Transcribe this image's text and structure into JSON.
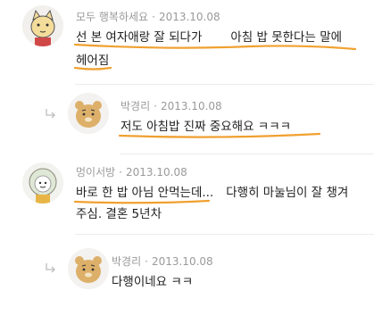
{
  "comments": [
    {
      "author": "모두 행복하세요",
      "date": "2013.10.08",
      "text_line1_a": "선 본 여자애랑 잘 되다가",
      "text_line1_b": "아침 밥 못한다는 말에",
      "text_line2": "헤어짐"
    },
    {
      "author": "박경리",
      "date": "2013.10.08",
      "text_line1": "저도 아침밥 진짜 중요해요 ㅋㅋㅋ"
    },
    {
      "author": "멍이서방",
      "date": "2013.10.08",
      "text_line1_a": "바로 한 밥 아님 안먹는데...",
      "text_line1_b": "다행히 마눌님이 잘 챙겨",
      "text_line2": "주심. 결혼 5년차"
    },
    {
      "author": "박경리",
      "date": "2013.10.08",
      "text_line1": "다행이네요 ㅋㅋ"
    }
  ],
  "separator": "·",
  "colors": {
    "highlight": "#f0a030",
    "meta": "#9a9a9a",
    "divider": "#ececec"
  }
}
